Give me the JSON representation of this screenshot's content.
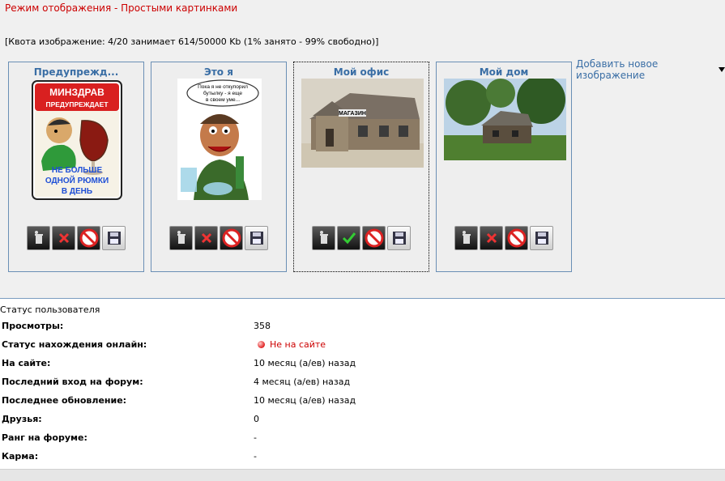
{
  "header": {
    "view_mode": "Режим отображения - Простыми картинками",
    "quota": "[Квота изображение: 4/20 занимает 614/50000 Kb (1% занято - 99% свободно)]"
  },
  "gallery": {
    "add_image_label": "Добавить новое изображение",
    "cards": [
      {
        "title": "Предупрежд...",
        "image_text": [
          "МИНЗДРАВ",
          "ПРЕДУПРЕЖДАЕТ",
          "НЕ БОЛЬШЕ",
          "ОДНОЙ РЮМКИ",
          "В ДЕНЬ"
        ]
      },
      {
        "title": "Это я",
        "image_text": [
          "Пока я не откупорил",
          "бутылку - я еще",
          "в своем уме..."
        ]
      },
      {
        "title": "Мой офис",
        "image_text": [
          "МАГАЗИН"
        ]
      },
      {
        "title": "Мой дом",
        "image_text": []
      }
    ]
  },
  "status": {
    "heading": "Статус пользователя",
    "rows": [
      {
        "label": "Просмотры:",
        "value": "358"
      },
      {
        "label": "Статус нахождения онлайн:",
        "value": "Не на сайте"
      },
      {
        "label": "На сайте:",
        "value": "10 месяц (а/ев) назад"
      },
      {
        "label": "Последний вход на форум:",
        "value": "4 месяц (а/ев) назад"
      },
      {
        "label": "Последнее обновление:",
        "value": "10 месяц (а/ев) назад"
      },
      {
        "label": "Друзья:",
        "value": "0"
      },
      {
        "label": "Ранг на форуме:",
        "value": "-"
      },
      {
        "label": "Карма:",
        "value": "-"
      }
    ]
  }
}
